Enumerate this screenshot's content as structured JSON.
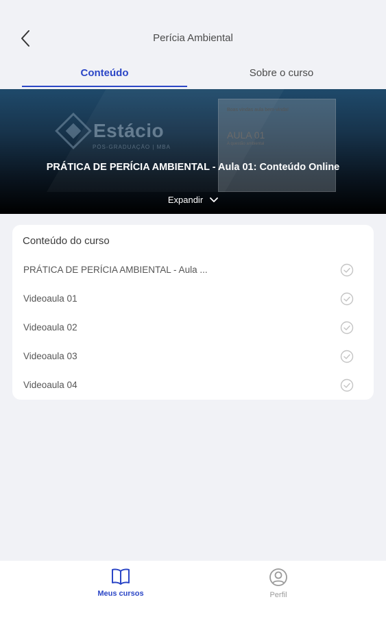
{
  "header": {
    "title": "Perícia Ambiental",
    "back_icon": "chevron-left-icon"
  },
  "tabs": [
    {
      "label": "Conteúdo",
      "active": true
    },
    {
      "label": "Sobre o curso",
      "active": false
    }
  ],
  "banner": {
    "logo_text": "Estácio",
    "logo_sub": "PÓS-GRADUAÇÃO | MBA",
    "card_small": "Boas vindas aula bem-vinda!",
    "card_aula": "AULA 01",
    "card_aula_sub": "A questão ambiental",
    "title": "PRÁTICA DE PERÍCIA AMBIENTAL - Aula 01: Conteúdo Online",
    "expand_label": "Expandir"
  },
  "course_content": {
    "title": "Conteúdo do curso",
    "lessons": [
      {
        "label": "PRÁTICA DE PERÍCIA AMBIENTAL - Aula ..."
      },
      {
        "label": "Videoaula 01"
      },
      {
        "label": "Videoaula 02"
      },
      {
        "label": "Videoaula 03"
      },
      {
        "label": "Videoaula 04"
      }
    ]
  },
  "bottom_nav": [
    {
      "label": "Meus cursos",
      "icon": "book-icon",
      "active": true
    },
    {
      "label": "Perfil",
      "icon": "user-icon",
      "active": false
    }
  ],
  "colors": {
    "accent": "#2b46c6",
    "background": "#f1f2f6"
  }
}
